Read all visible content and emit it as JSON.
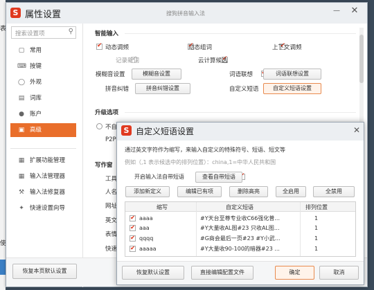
{
  "main_window": {
    "title": "属性设置",
    "center_title": "搜狗拼音输入法",
    "search_placeholder": "搜索设置项",
    "edge_char_left": "表",
    "edge_char_left2": "使"
  },
  "sidebar": {
    "items": [
      {
        "label": "常用",
        "icon": "monitor-icon"
      },
      {
        "label": "按键",
        "icon": "keyboard-icon"
      },
      {
        "label": "外观",
        "icon": "tshirt-icon"
      },
      {
        "label": "词库",
        "icon": "book-icon"
      },
      {
        "label": "账户",
        "icon": "user-icon"
      },
      {
        "label": "高级",
        "icon": "briefcase-icon"
      },
      {
        "label": "扩展功能管理",
        "icon": "grid-icon"
      },
      {
        "label": "输入法管理器",
        "icon": "grid-icon"
      },
      {
        "label": "输入法修复器",
        "icon": "wrench-icon"
      },
      {
        "label": "快速设置向导",
        "icon": "wand-icon"
      }
    ],
    "restore_button": "恢复本页默认设置"
  },
  "smart_input": {
    "heading": "智能输入",
    "dynamic_freq": "动态调频",
    "dynamic_compose": "动态组词",
    "context_freq": "上下文调频",
    "remember_new": "记录新词",
    "cloud_candidates": "云计算候选",
    "fuzzy_label": "模糊音设置",
    "fuzzy_button": "模糊音设置",
    "assoc_label": "词语联想",
    "assoc_button": "词语联想设置",
    "correct_label": "拼音纠错",
    "correct_button": "拼音纠错设置",
    "phrase_label": "自定义短语",
    "phrase_button": "自定义短语设置"
  },
  "upgrade": {
    "heading": "升级选项",
    "opt1": "不自",
    "opt2": "P2P"
  },
  "writing": {
    "heading": "写作窗",
    "items": [
      "工具",
      "人名",
      "网址",
      "英文",
      "表情",
      "快速"
    ]
  },
  "dialog": {
    "title": "自定义短语设置",
    "description": "通过英文字符作为缩写，来输入自定义的特殊符号、短语、短文等",
    "example": "例如（,1 表示候选中的排列位置）：china,1=中华人民共和国",
    "enable_label": "开启输入法自带短语",
    "view_builtin": "查看自带短语",
    "toolbar": [
      "添加新定义",
      "编辑已有项",
      "删除高亮",
      "全启用",
      "全禁用"
    ],
    "columns": [
      "缩写",
      "自定义短语",
      "排列位置"
    ],
    "rows": [
      {
        "abbr": "aaaa",
        "phrase": "#Y天台至尊专业收C66强化普...",
        "pos": "1"
      },
      {
        "abbr": "aaa",
        "phrase": "#Y大量收AL图#23 只收AL图...",
        "pos": "1"
      },
      {
        "abbr": "qqqq",
        "phrase": "#G商会最后一页#23 #Y小武...",
        "pos": "1"
      },
      {
        "abbr": "aaaaa",
        "phrase": "#Y大量收90-100的暗器#23 ...",
        "pos": "1"
      }
    ],
    "restore_button": "恢复默认设置",
    "edit_config_button": "直接编辑配置文件",
    "ok_button": "确定",
    "cancel_button": "取消"
  },
  "colors": {
    "accent": "#e96e2b",
    "brand_red": "#e0391f",
    "title_bar": "#eceff2"
  }
}
